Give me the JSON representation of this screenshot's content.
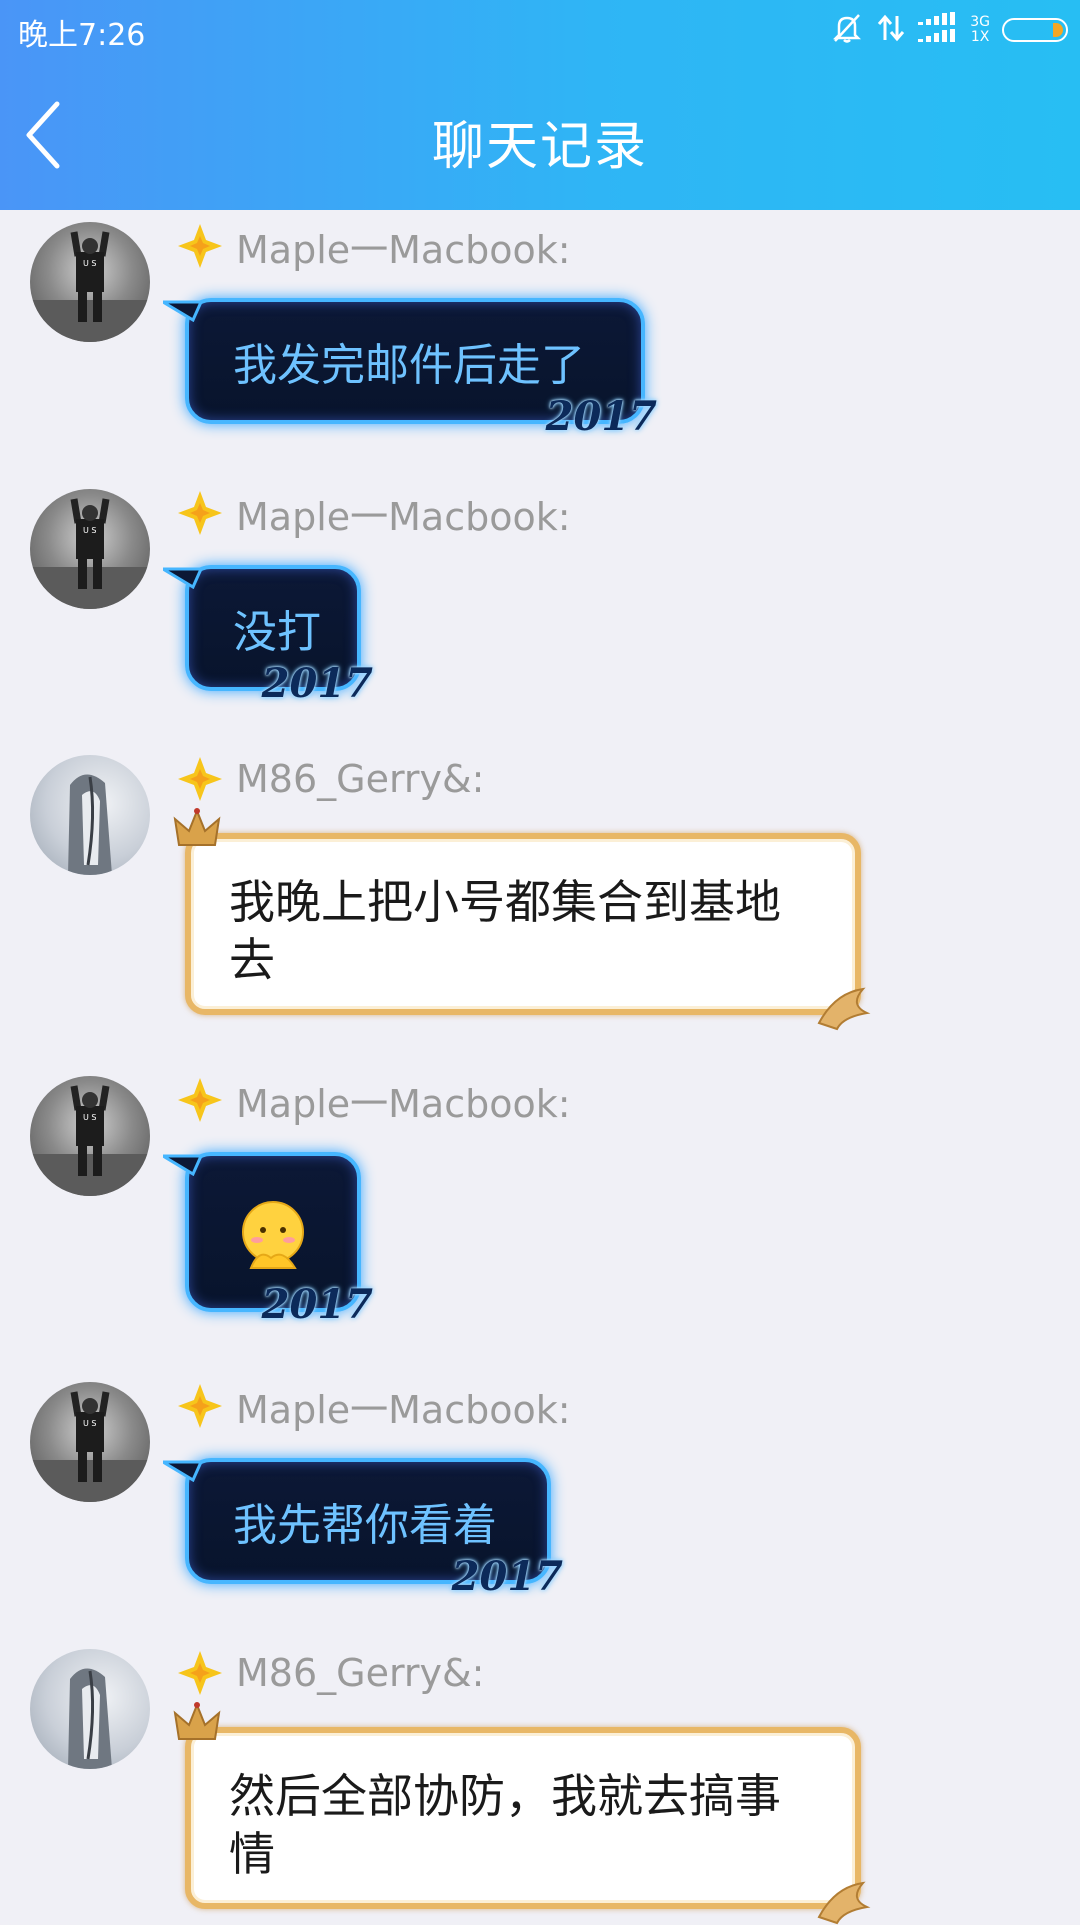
{
  "status": {
    "time": "晚上7:26",
    "network": [
      "3G",
      "1X"
    ]
  },
  "header": {
    "title": "聊天记录"
  },
  "messages": [
    {
      "sender": "Maple一Macbook:",
      "text": "我发完邮件后走了",
      "style": "dark",
      "badge": "2017"
    },
    {
      "sender": "Maple一Macbook:",
      "text": "没打",
      "style": "dark",
      "badge": "2017"
    },
    {
      "sender": "M86_Gerry&:",
      "text": "我晚上把小号都集合到基地去",
      "style": "light"
    },
    {
      "sender": "Maple一Macbook:",
      "text": "",
      "style": "dark",
      "emoji": "shy-face-emoji",
      "badge": "2017"
    },
    {
      "sender": "Maple一Macbook:",
      "text": "我先帮你看着",
      "style": "dark",
      "badge": "2017"
    },
    {
      "sender": "M86_Gerry&:",
      "text": "然后全部协防，我就去搞事情",
      "style": "light"
    }
  ],
  "colors": {
    "header_start": "#4a95f7",
    "header_end": "#27bef3",
    "background": "#f0f0f6",
    "sender_name": "#9a9a9a",
    "dark_bubble_text": "#6ec2ff",
    "light_bubble_border": "#e8b766",
    "vip_star": "#f7c51b"
  }
}
